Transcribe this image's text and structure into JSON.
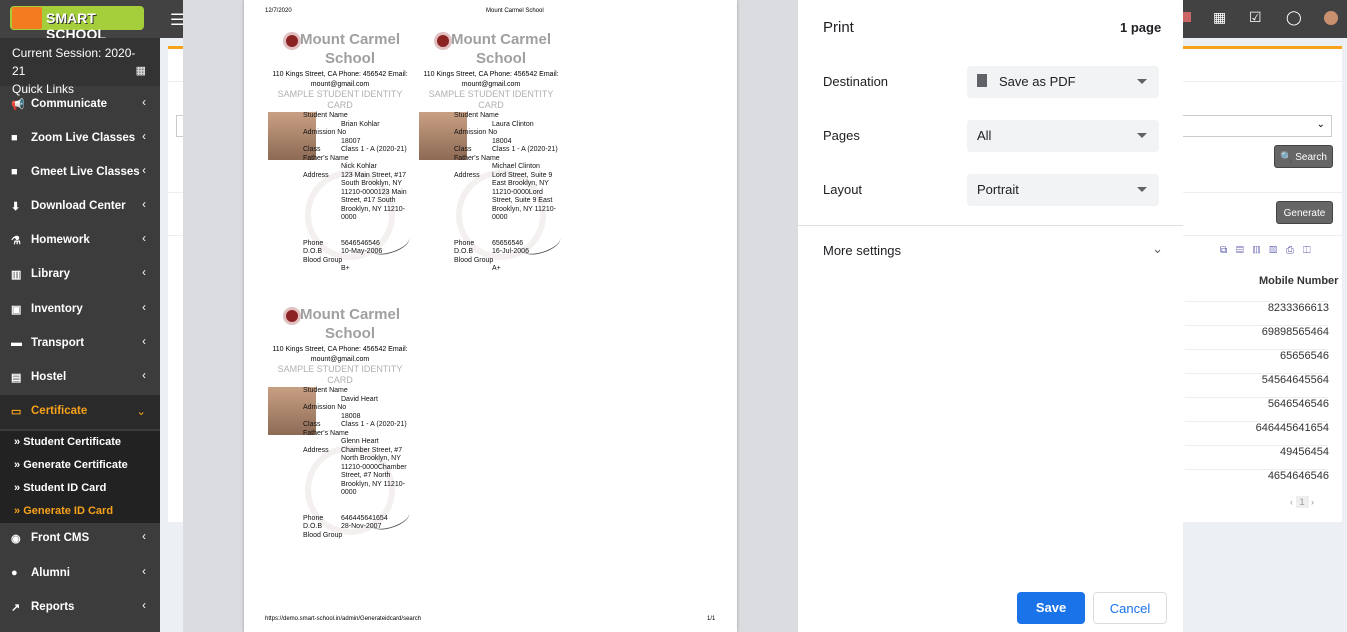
{
  "topbar": {
    "brand": "SMART SCHOOL",
    "menu_icon": "hamburger-icon",
    "icons": [
      "flag-icon",
      "calendar-icon",
      "check-square-icon",
      "whatsapp-icon",
      "avatar"
    ]
  },
  "sidebar": {
    "session": "Current Session: 2020-21",
    "quick_links": "Quick Links",
    "items": [
      {
        "label": "Communicate",
        "icon": "bullhorn-icon"
      },
      {
        "label": "Zoom Live Classes",
        "icon": "video-icon"
      },
      {
        "label": "Gmeet Live Classes",
        "icon": "video-icon"
      },
      {
        "label": "Download Center",
        "icon": "download-icon"
      },
      {
        "label": "Homework",
        "icon": "flask-icon"
      },
      {
        "label": "Library",
        "icon": "book-icon"
      },
      {
        "label": "Inventory",
        "icon": "inventory-icon"
      },
      {
        "label": "Transport",
        "icon": "bus-icon"
      },
      {
        "label": "Hostel",
        "icon": "building-icon"
      },
      {
        "label": "Certificate",
        "icon": "certificate-icon",
        "active": true
      }
    ],
    "subitems": [
      {
        "label": "Student Certificate"
      },
      {
        "label": "Generate Certificate"
      },
      {
        "label": "Student ID Card"
      },
      {
        "label": "Generate ID Card",
        "active": true
      }
    ],
    "items_after": [
      {
        "label": "Front CMS",
        "icon": "cms-icon"
      },
      {
        "label": "Alumni",
        "icon": "graduation-icon"
      },
      {
        "label": "Reports",
        "icon": "chart-icon"
      }
    ]
  },
  "preview": {
    "date": "12/7/2020",
    "header_title": "Mount Carmel School",
    "footer_url": "https://demo.smart-school.in/admin/Generateidcard/search",
    "footer_page": "1/1",
    "cards": [
      {
        "school": "Mount Carmel School",
        "address": "110 Kings Street, CA Phone: 456542 Email: mount@gmail.com",
        "title": "SAMPLE STUDENT IDENTITY CARD",
        "student_name": "Brian Kohlar",
        "admission_no": "18007",
        "class": "Class 1 - A (2020-21)",
        "father_name": "Nick Kohlar",
        "address_value": "123 Main Street, #17 South Brooklyn, NY 11210-0000123 Main Street, #17 South Brooklyn, NY 11210-0000",
        "phone": "5646546546",
        "dob": "10-May-2006",
        "blood_group": "B+"
      },
      {
        "school": "Mount Carmel School",
        "address": "110 Kings Street, CA Phone: 456542 Email: mount@gmail.com",
        "title": "SAMPLE STUDENT IDENTITY CARD",
        "student_name": "Laura Clinton",
        "admission_no": "18004",
        "class": "Class 1 - A (2020-21)",
        "father_name": "Michael Clinton",
        "address_value": "Lord Street, Suite 9 East Brooklyn, NY 11210-0000Lord Street, Suite 9 East Brooklyn, NY 11210-0000",
        "phone": "65656546",
        "dob": "16-Jul-2006",
        "blood_group": "A+"
      },
      {
        "school": "Mount Carmel School",
        "address": "110 Kings Street, CA Phone: 456542 Email: mount@gmail.com",
        "title": "SAMPLE STUDENT IDENTITY CARD",
        "student_name": "David Heart",
        "admission_no": "18008",
        "class": "Class 1 - A (2020-21)",
        "father_name": "Glenn Heart",
        "address_value": "Chamber Street, #7 North Brooklyn, NY 11210-0000Chamber Street, #7 North Brooklyn, NY 11210-0000",
        "phone": "646445641654",
        "dob": "28-Nov-2007",
        "blood_group": ""
      }
    ],
    "labels": {
      "student_name": "Student Name",
      "admission_no": "Admission No",
      "class": "Class",
      "father_name": "Father's Name",
      "address": "Address",
      "phone": "Phone",
      "dob": "D.O.B",
      "blood_group": "Blood Group"
    }
  },
  "print": {
    "title": "Print",
    "pages_count": "1 page",
    "destination_label": "Destination",
    "destination": "Save as PDF",
    "pages_label": "Pages",
    "pages": "All",
    "layout_label": "Layout",
    "layout": "Portrait",
    "more_settings": "More settings",
    "save": "Save",
    "cancel": "Cancel",
    "accent": "#1a73e8"
  },
  "background_page": {
    "search": "Search",
    "generate": "Generate",
    "mobile_header": "Mobile Number",
    "mobiles": [
      "8233366613",
      "69898565464",
      "65656546",
      "54564645564",
      "5646546546",
      "646445641654",
      "49456454",
      "4654646546"
    ],
    "page": "1",
    "export_icons": [
      "copy-icon",
      "excel-icon",
      "csv-icon",
      "pdf-icon",
      "print-icon",
      "columns-icon"
    ]
  }
}
